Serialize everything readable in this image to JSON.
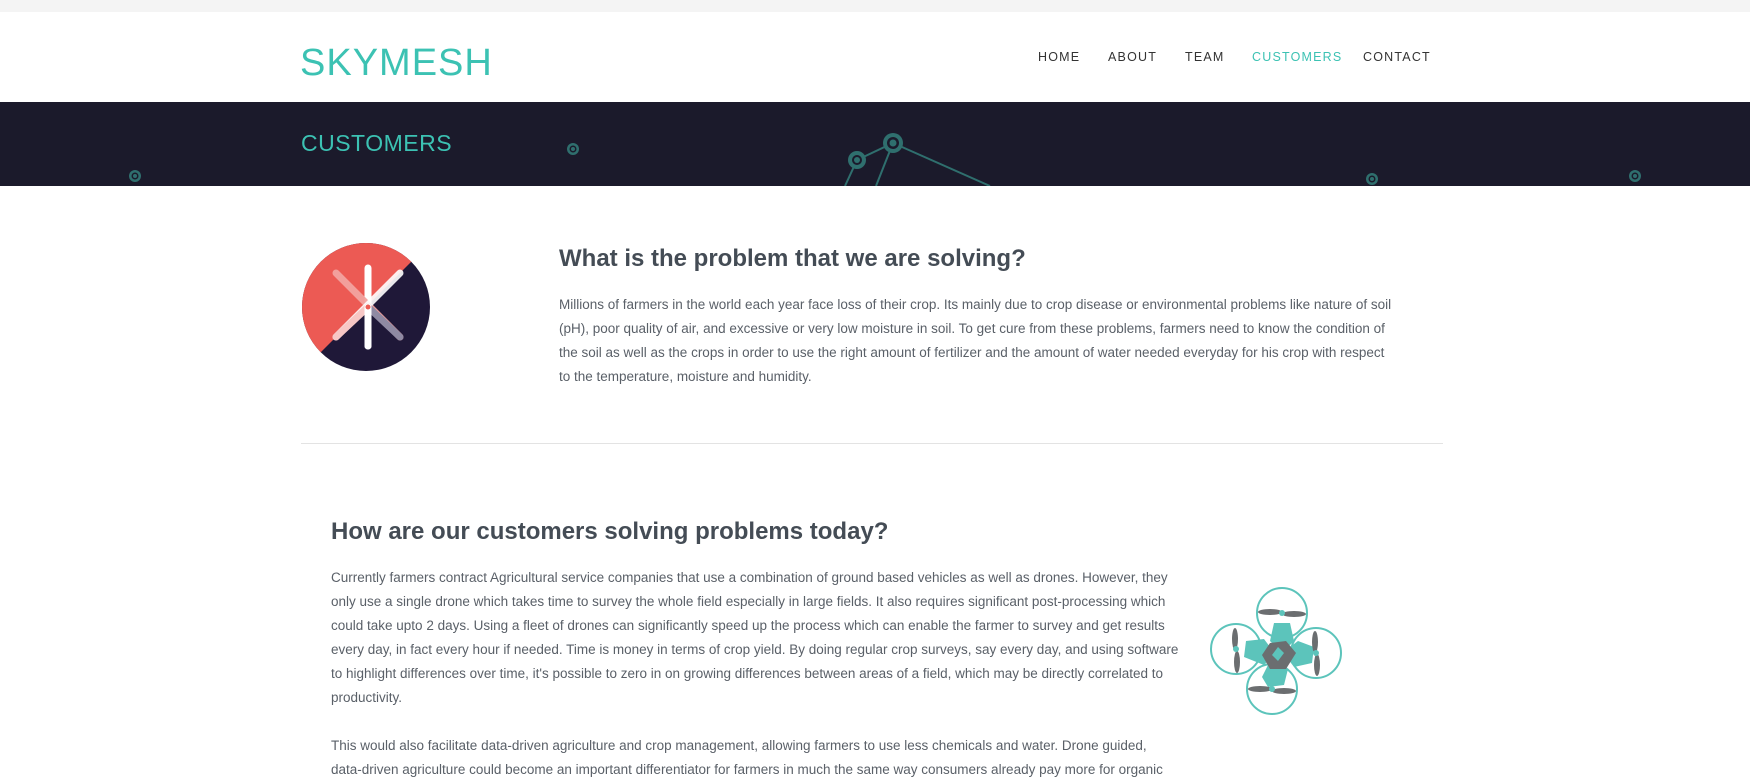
{
  "brand": {
    "logo_text": "SKYMESH",
    "accent": "#3cc2b3",
    "dark_banner": "#1b1a2b"
  },
  "nav": {
    "items": [
      {
        "label": "HOME",
        "active": false
      },
      {
        "label": "ABOUT",
        "active": false
      },
      {
        "label": "TEAM",
        "active": false
      },
      {
        "label": "CUSTOMERS",
        "active": true
      },
      {
        "label": "CONTACT",
        "active": false
      }
    ]
  },
  "banner": {
    "title": "CUSTOMERS"
  },
  "section1": {
    "heading": "What is the problem that we are solving?",
    "lines": [
      "Millions of farmers in the world each year face loss of their crop. Its mainly due to crop disease or environmental problems like nature of soil",
      "(pH), poor quality of air, and excessive or very low moisture in soil. To get cure from these problems, farmers need to know the condition of",
      "the soil as well as the crops in order to use the right amount of fertilizer and the amount of water needed everyday for his crop with respect",
      "to the temperature, moisture and humidity."
    ],
    "icon": "skymesh-logo-icon"
  },
  "section2": {
    "heading": "How are our customers solving problems today?",
    "para1_lines": [
      "Currently farmers contract Agricultural service companies that use a combination of ground based vehicles as well as drones. However, they",
      "only use a single drone which takes time to survey the whole field especially in large fields. It also requires significant post-processing which",
      "could take upto 2 days. Using a fleet of drones can significantly speed up the process which can enable the farmer to survey and get results",
      "every day, in fact every hour if needed. Time is money in terms of crop yield. By doing regular crop surveys, say every day, and using software",
      "to highlight differences over time, it's possible to zero in on growing differences between areas of a field, which may be directly correlated to",
      "productivity."
    ],
    "para2_lines": [
      "This would also facilitate data-driven agriculture and crop management, allowing farmers to use less chemicals and water. Drone guided,",
      "data-driven agriculture could become an important differentiator for farmers in much the same way consumers already pay more for organic"
    ],
    "icon": "drone-icon"
  }
}
